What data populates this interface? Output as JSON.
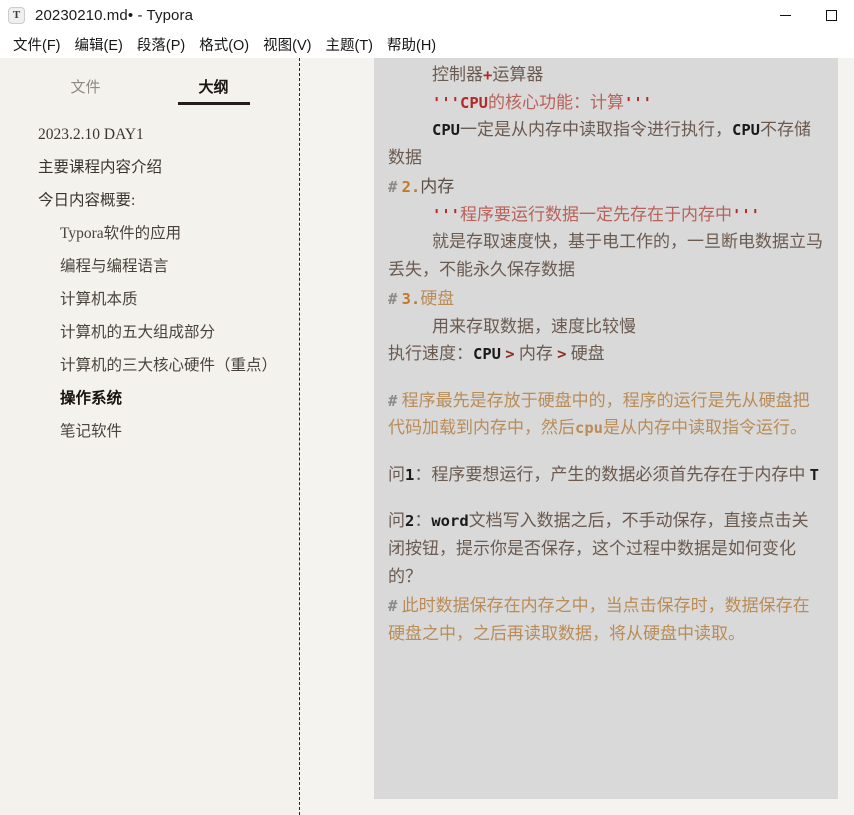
{
  "window": {
    "app_icon_glyph": "T",
    "title": "20230210.md• - Typora",
    "minimize_label": "—",
    "maximize_label": "□"
  },
  "menubar": {
    "items": [
      {
        "label": "文件(F)"
      },
      {
        "label": "编辑(E)"
      },
      {
        "label": "段落(P)"
      },
      {
        "label": "格式(O)"
      },
      {
        "label": "视图(V)"
      },
      {
        "label": "主题(T)"
      },
      {
        "label": "帮助(H)"
      }
    ]
  },
  "sidebar": {
    "tabs": [
      {
        "label": "文件",
        "active": false
      },
      {
        "label": "大纲",
        "active": true
      }
    ],
    "outline": [
      {
        "label": "2023.2.10 DAY1",
        "level": 1,
        "current": false
      },
      {
        "label": "主要课程内容介绍",
        "level": 1,
        "current": false
      },
      {
        "label": "今日内容概要:",
        "level": 1,
        "current": false
      },
      {
        "label": "Typora软件的应用",
        "level": 2,
        "current": false
      },
      {
        "label": "编程与编程语言",
        "level": 2,
        "current": false
      },
      {
        "label": "计算机本质",
        "level": 2,
        "current": false
      },
      {
        "label": "计算机的五大组成部分",
        "level": 2,
        "current": false
      },
      {
        "label": "计算机的三大核心硬件（重点）",
        "level": 2,
        "current": false
      },
      {
        "label": "操作系统",
        "level": 2,
        "current": true
      },
      {
        "label": "笔记软件",
        "level": 2,
        "current": false
      }
    ]
  },
  "document": {
    "l1_a": "控制器",
    "l1_plus": "+",
    "l1_b": "运算器",
    "l2_q1": "'''",
    "l2_cpu": "CPU",
    "l2_mid": "的核心功能：计算",
    "l2_q2": "'''",
    "l3_cpu1": "CPU",
    "l3_mid": "一定是从内存中读取指令进行执行，",
    "l3_cpu2": "CPU",
    "l3_end": "不存储数据",
    "h2_hash": "#",
    "h2_num": "2.",
    "h2_text": "内存",
    "l4_q1": "'''",
    "l4_text": "程序要运行数据一定先存在于内存中",
    "l4_q2": "'''",
    "l5": "就是存取速度快，基于电工作的，一旦断电数据立马丢失，不能永久保存数据",
    "h3_hash": "#",
    "h3_num": "3.",
    "h3_text": "硬盘",
    "l6": "用来存取数据，速度比较慢",
    "l7_label": "执行速度：",
    "l7_cpu": "CPU",
    "l7_gt1": ">",
    "l7_mem": "内存",
    "l7_gt2": ">",
    "l7_disk": "硬盘",
    "b1_hash": "#",
    "b1_a": "程序最先是存放于硬盘中的，程序的运行是先从硬盘把代码加载到内存中，然后",
    "b1_cpu": "cpu",
    "b1_b": "是从内存中读取指令运行。",
    "q1_label": "问",
    "q1_num": "1",
    "q1_text": "：程序要想运行，产生的数据必须首先存在于内存中",
    "q1_answer": "T",
    "q2_label": "问",
    "q2_num": "2",
    "q2_word": "word",
    "q2_text_a": "：",
    "q2_text_b": "文档写入数据之后，不手动保存，直接点击关闭按钮，提示你是否保存，这个过程中数据是如何变化的？",
    "b2_hash": "#",
    "b2_text": "此时数据保存在内存之中，当点击保存时，数据保存在硬盘之中，之后再读取数据，将从硬盘中读取。"
  },
  "colors": {
    "page_background": "#f5f3ef",
    "sidebar_background": "#f4f2ed",
    "doc_background": "#d9d9d9",
    "body_text": "#6b5a50",
    "accent_red": "#b32a2a",
    "accent_orange": "#c07a2a",
    "accent_tan": "#b98c58",
    "quote_red": "#b8625a",
    "titlebar_background": "#ffffff"
  }
}
